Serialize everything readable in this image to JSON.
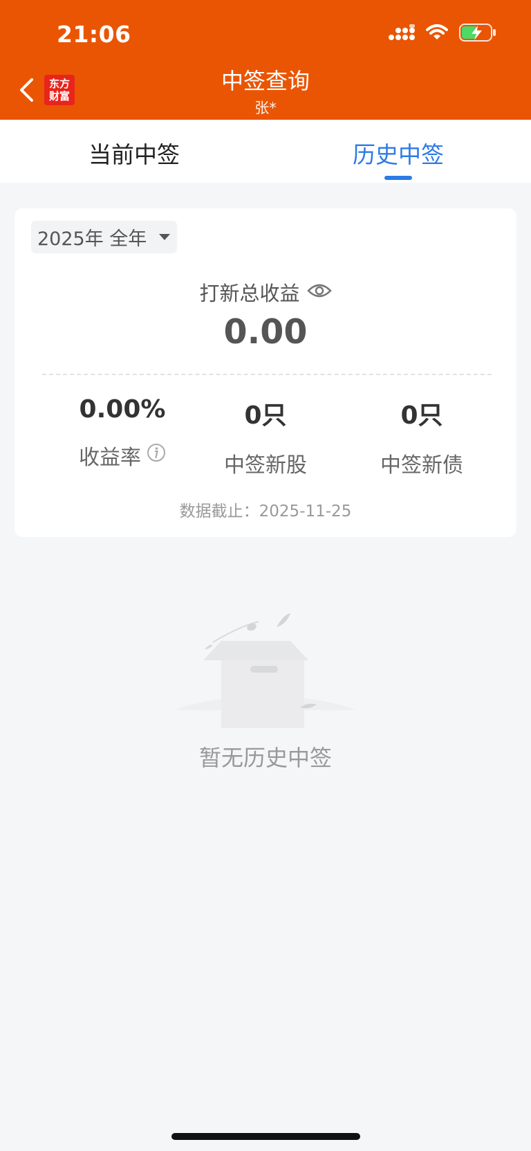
{
  "status_bar": {
    "time": "21:06",
    "icons": [
      "cellular-signal-icon",
      "wifi-icon",
      "battery-charging-icon"
    ]
  },
  "header": {
    "brand_line1": "东方",
    "brand_line2": "财富",
    "title": "中签查询",
    "subtitle": "张*",
    "background_color": "#ea5504"
  },
  "tabs": {
    "current": "当前中签",
    "history": "历史中签",
    "active_color": "#2e7ae6"
  },
  "summary": {
    "year_filter": "2025年 全年",
    "total_label": "打新总收益",
    "total_value": "0.00",
    "stats": [
      {
        "value": "0.00%",
        "label": "收益率"
      },
      {
        "value": "0只",
        "label": "中签新股"
      },
      {
        "value": "0只",
        "label": "中签新债"
      }
    ],
    "data_date": "数据截止：2025-11-25"
  },
  "empty_state": {
    "text": "暂无历史中签"
  }
}
